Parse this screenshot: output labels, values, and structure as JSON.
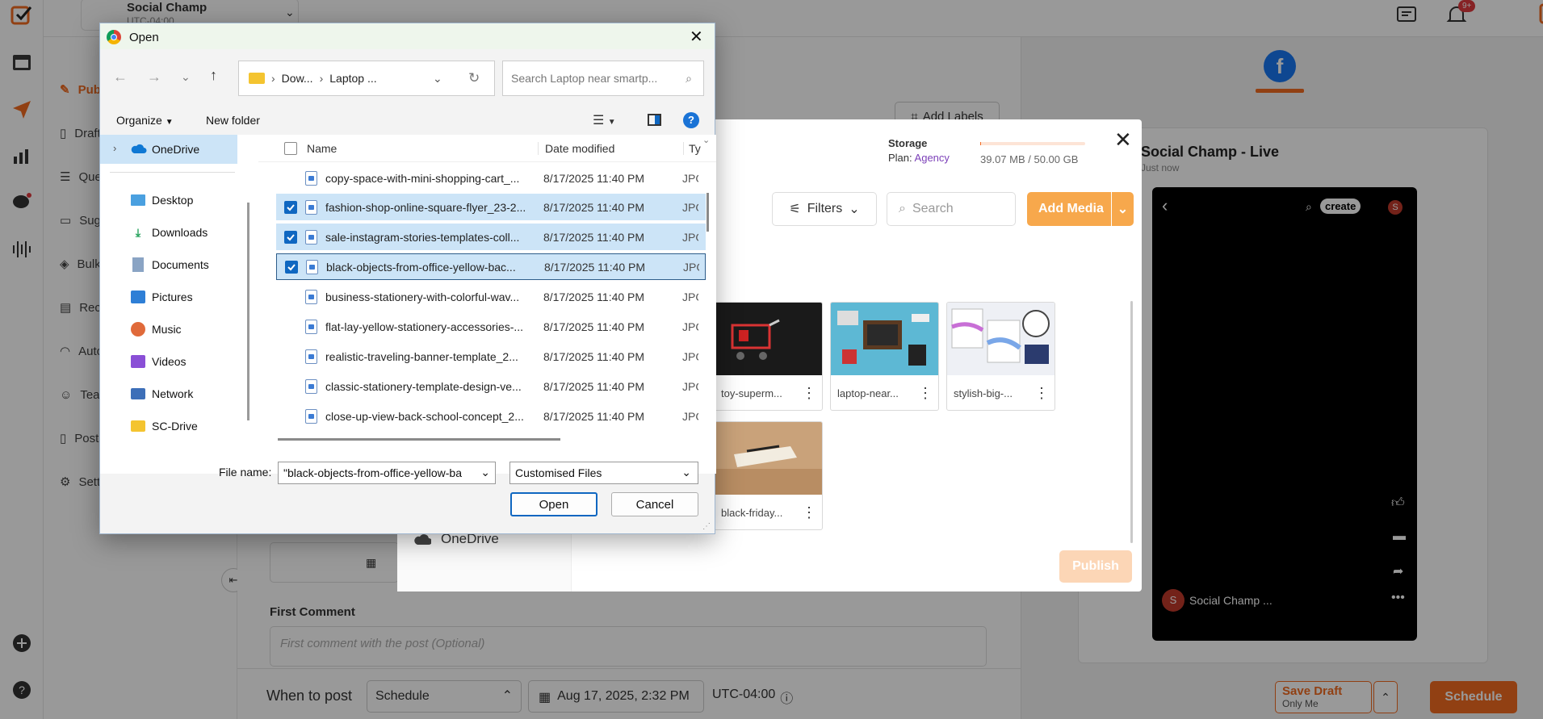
{
  "app": {
    "name": "Social Champ",
    "timezone": "UTC-04:00",
    "notification_count": "9+"
  },
  "sidebar": {
    "items": [
      {
        "label": "Publish",
        "icon": "pencil-icon"
      },
      {
        "label": "Drafts",
        "icon": "document-icon"
      },
      {
        "label": "Queue",
        "icon": "list-icon"
      },
      {
        "label": "Suggestions",
        "icon": "bookmark-icon"
      },
      {
        "label": "Bulk",
        "icon": "layers-icon"
      },
      {
        "label": "Recycle",
        "icon": "archive-icon"
      },
      {
        "label": "Automation",
        "icon": "rss-icon"
      },
      {
        "label": "Team",
        "icon": "user-icon"
      },
      {
        "label": "Posts",
        "icon": "file-icon"
      },
      {
        "label": "Settings",
        "icon": "gear-icon"
      }
    ]
  },
  "composer": {
    "add_labels": "Add Labels",
    "first_comment_label": "First Comment",
    "first_comment_placeholder": "First comment with the post (Optional)",
    "when_to_post": "When to post",
    "schedule_option": "Schedule",
    "date": "Aug 17, 2025, 2:32 PM",
    "timezone": "UTC-04:00",
    "save_draft": "Save Draft",
    "only_me": "Only Me",
    "schedule_button": "Schedule",
    "onedrive_label": "OneDrive"
  },
  "preview": {
    "page_name": "Social Champ - Live",
    "time": "Just now",
    "story_name": "Social Champ ...",
    "create_label": "create",
    "avatar_letter": "S"
  },
  "media_modal": {
    "storage_title": "Storage",
    "plan_label": "Plan:",
    "plan_value": "Agency",
    "storage_used": "39.07 MB / 50.00 GB",
    "storage_fraction": 0.0008,
    "filters": "Filters",
    "search_placeholder": "Search",
    "add_media": "Add Media",
    "publish": "Publish",
    "cards": [
      {
        "caption": "toy-superm..."
      },
      {
        "caption": "laptop-near..."
      },
      {
        "caption": "stylish-big-..."
      },
      {
        "caption": "black-friday..."
      }
    ]
  },
  "file_dialog": {
    "title": "Open",
    "breadcrumb": [
      "Dow...",
      "Laptop ..."
    ],
    "search_placeholder": "Search Laptop near smartp...",
    "organize": "Organize",
    "new_folder": "New folder",
    "columns": {
      "name": "Name",
      "date": "Date modified",
      "type": "Ty"
    },
    "tree": [
      {
        "label": "OneDrive"
      },
      {
        "label": "Desktop"
      },
      {
        "label": "Downloads"
      },
      {
        "label": "Documents"
      },
      {
        "label": "Pictures"
      },
      {
        "label": "Music"
      },
      {
        "label": "Videos"
      },
      {
        "label": "Network"
      },
      {
        "label": "SC-Drive"
      }
    ],
    "files": [
      {
        "name": "copy-space-with-mini-shopping-cart_...",
        "date": "8/17/2025 11:40 PM",
        "type": "JPG",
        "selected": false
      },
      {
        "name": "fashion-shop-online-square-flyer_23-2...",
        "date": "8/17/2025 11:40 PM",
        "type": "JPG",
        "selected": true
      },
      {
        "name": "sale-instagram-stories-templates-coll...",
        "date": "8/17/2025 11:40 PM",
        "type": "JPG",
        "selected": true
      },
      {
        "name": "black-objects-from-office-yellow-bac...",
        "date": "8/17/2025 11:40 PM",
        "type": "JPG",
        "selected": true
      },
      {
        "name": "business-stationery-with-colorful-wav...",
        "date": "8/17/2025 11:40 PM",
        "type": "JPG",
        "selected": false
      },
      {
        "name": "flat-lay-yellow-stationery-accessories-...",
        "date": "8/17/2025 11:40 PM",
        "type": "JPG",
        "selected": false
      },
      {
        "name": "realistic-traveling-banner-template_2...",
        "date": "8/17/2025 11:40 PM",
        "type": "JPG",
        "selected": false
      },
      {
        "name": "classic-stationery-template-design-ve...",
        "date": "8/17/2025 11:40 PM",
        "type": "JPG",
        "selected": false
      },
      {
        "name": "close-up-view-back-school-concept_2...",
        "date": "8/17/2025 11:40 PM",
        "type": "JPG",
        "selected": false
      }
    ],
    "file_name_label": "File name:",
    "file_name_value": "\"black-objects-from-office-yellow-ba",
    "file_type": "Customised Files",
    "open_button": "Open",
    "cancel_button": "Cancel"
  }
}
